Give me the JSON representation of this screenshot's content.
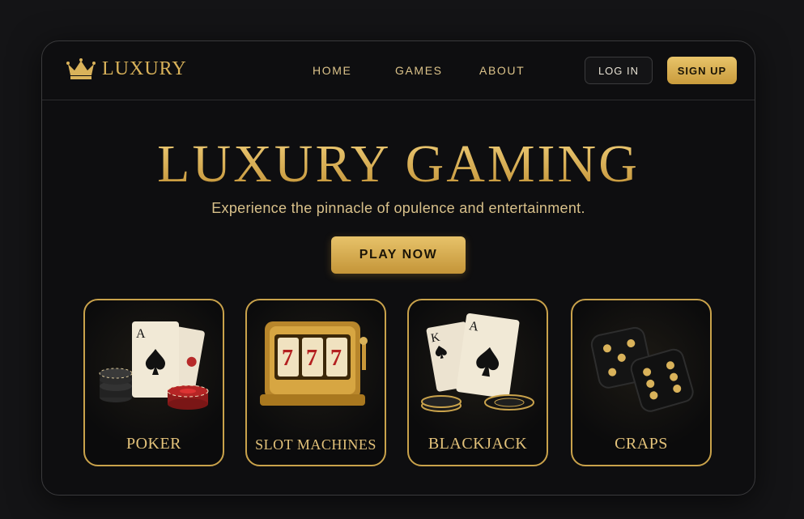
{
  "brand": {
    "name": "LUXURY",
    "icon": "crown-icon"
  },
  "nav": {
    "links": [
      "HOME",
      "GAMES",
      "ABOUT"
    ]
  },
  "auth": {
    "login_label": "LOG IN",
    "signup_label": "SIGN UP"
  },
  "hero": {
    "title": "LUXURY GAMING",
    "subtitle": "Experience the pinnacle of opulence and entertainment.",
    "cta_label": "PLAY NOW"
  },
  "games": [
    {
      "label": "POKER",
      "icon": "poker-cards-chips-icon"
    },
    {
      "label": "SLOT MACHINES",
      "icon": "slot-machine-icon"
    },
    {
      "label": "BLACKJACK",
      "icon": "blackjack-cards-icon"
    },
    {
      "label": "CRAPS",
      "icon": "dice-icon"
    }
  ],
  "colors": {
    "background": "#0e0e10",
    "gold": "#d9b25a",
    "gold_light": "#e8c46a",
    "text_light": "#dcc38a"
  }
}
